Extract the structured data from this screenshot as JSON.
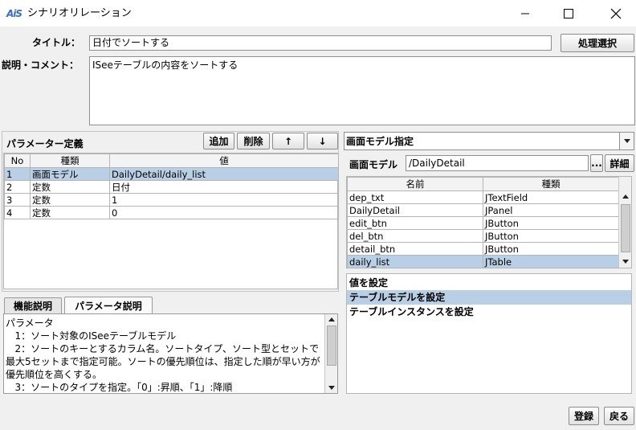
{
  "window": {
    "logo": "AiS",
    "title": "シナリオリレーション"
  },
  "form": {
    "title_label": "タイトル：",
    "title_value": "日付でソートする",
    "process_select_button": "処理選択",
    "comment_label": "説明・コメント：",
    "comment_value": "ISeeテーブルの内容をソートする"
  },
  "params": {
    "panel_title": "パラメーター定義",
    "add_button": "追加",
    "delete_button": "削除",
    "up_button": "↑",
    "down_button": "↓",
    "columns": [
      "No",
      "種類",
      "値"
    ],
    "rows": [
      {
        "no": "1",
        "kind": "画面モデル",
        "value": "DailyDetail/daily_list",
        "selected": true
      },
      {
        "no": "2",
        "kind": "定数",
        "value": "日付",
        "selected": false
      },
      {
        "no": "3",
        "kind": "定数",
        "value": "1",
        "selected": false
      },
      {
        "no": "4",
        "kind": "定数",
        "value": "0",
        "selected": false
      }
    ]
  },
  "tabs": {
    "function_desc": "機能説明",
    "param_desc": "パラメータ説明",
    "active": "param_desc"
  },
  "description_lines": [
    "パラメータ",
    "   1：ソート対象のISeeテーブルモデル",
    "   2：ソートのキーとするカラム名。ソートタイプ、ソート型とセットで",
    "最大5セットまで指定可能。ソートの優先順位は、指定した順が早い方が",
    "優先順位を高くする。",
    "   3：ソートのタイプを指定。「0」:昇順、「1」:降順"
  ],
  "model": {
    "dropdown_value": "画面モデル指定",
    "label": "画面モデル",
    "value": "/DailyDetail",
    "ellipsis_button": "...",
    "detail_button": "詳細",
    "columns": [
      "名前",
      "種類"
    ],
    "rows": [
      {
        "name": "dep_txt",
        "type": "JTextField",
        "selected": false
      },
      {
        "name": "DailyDetail",
        "type": "JPanel",
        "selected": false
      },
      {
        "name": "edit_btn",
        "type": "JButton",
        "selected": false
      },
      {
        "name": "del_btn",
        "type": "JButton",
        "selected": false
      },
      {
        "name": "detail_btn",
        "type": "JButton",
        "selected": false
      },
      {
        "name": "daily_list",
        "type": "JTable",
        "selected": true
      }
    ]
  },
  "actions": {
    "items": [
      {
        "label": "値を設定",
        "selected": false
      },
      {
        "label": "テーブルモデルを設定",
        "selected": true
      },
      {
        "label": "テーブルインスタンスを設定",
        "selected": false
      }
    ]
  },
  "footer": {
    "register_button": "登録",
    "back_button": "戻る"
  },
  "colors": {
    "selection": "#b8cfe5",
    "logo": "#3a6fc0"
  }
}
